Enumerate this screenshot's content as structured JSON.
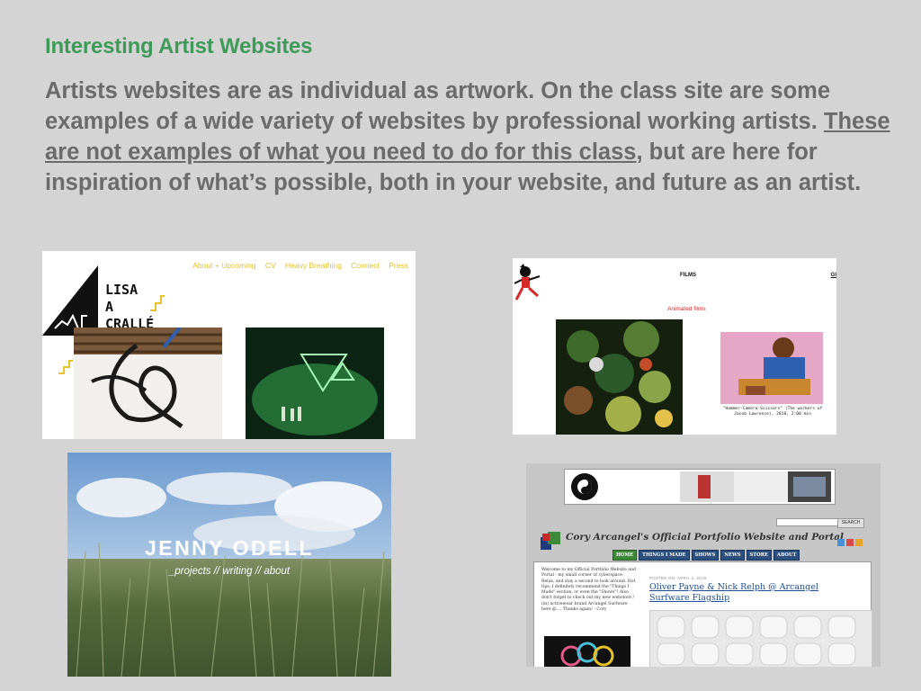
{
  "slide": {
    "title": "Interesting Artist Websites",
    "body_before": "Artists websites are as individual as artwork. On the class site are some examples of a wide variety of websites by professional working artists. ",
    "body_underlined": "These are not examples of what you need to do for this class",
    "body_after": ", but are here for inspiration of what’s possible, both in your website, and future as an artist."
  },
  "screenshots": {
    "lisa": {
      "nav": [
        "About + Upcoming",
        "CV",
        "Heavy Breathing",
        "Connect",
        "Press"
      ],
      "logo_line1": "LISA",
      "logo_line2": "A",
      "logo_line3": "CRALLÉ"
    },
    "films": {
      "header": "FILMS",
      "header_right": "GI",
      "subheading": "Animated films",
      "caption": "\"Hammer-Camera-Scissors\" (The workers of Jacob Lawrence), 2018, 2:00 min"
    },
    "jenny": {
      "name": "JENNY ODELL",
      "links": "_projects  //  writing  //  about"
    },
    "cory": {
      "search_button": "SEARCH",
      "site_title": "Cory Arcangel's Official Portfolio Website and Portal",
      "tabs": [
        "HOME",
        "THINGS I MADE",
        "SHOWS",
        "NEWS",
        "STORE",
        "ABOUT"
      ],
      "welcome_text": "Welcome to my Official Portfolio Website and Portal - my small corner of cyberspace. Relax, and stay a second to look around. Hot tips: I definitely recommend the \"Things I Made\" section, or even the \"Shows\"! Also don't forget to check out my new webstore / (in) activewear brand Arcangel Surfware here @.... Thanks again! - Cory",
      "posted": "POSTED ON: APRIL 3, 2019",
      "post_title": "Oliver Payne & Nick Relph @ Arcangel Surfware Flagship"
    }
  }
}
